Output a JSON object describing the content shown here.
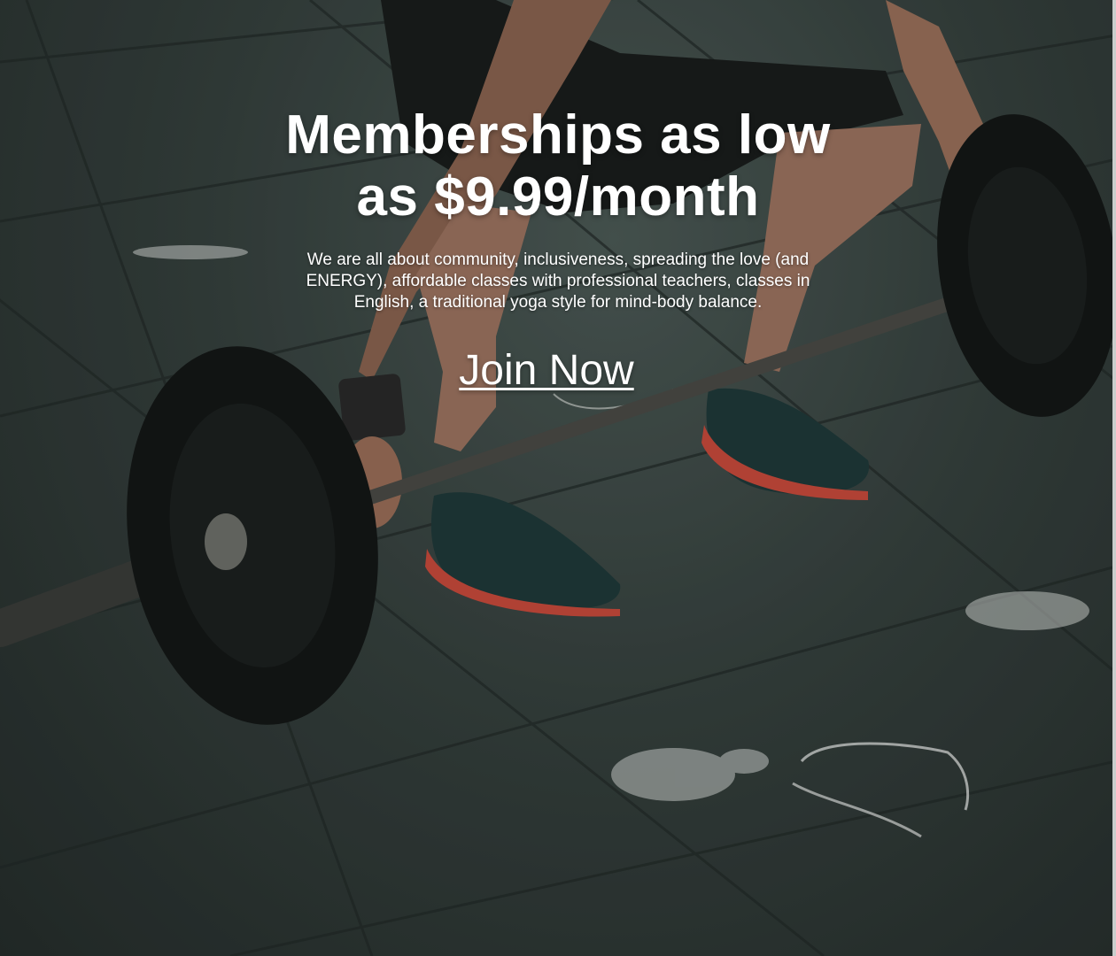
{
  "hero": {
    "headline": "Memberships as low as $9.99/month",
    "description": "We are all about community, inclusiveness, spreading the love (and ENERGY), affordable classes with professional teachers, classes in English, a traditional yoga style for mind-body balance.",
    "cta_label": "Join Now",
    "background_image": "man-lifting-barbell-photo"
  },
  "colors": {
    "text": "#ffffff",
    "floor": "#3a4643",
    "plate": "#141716",
    "shoe_accent": "#c94a3c"
  }
}
